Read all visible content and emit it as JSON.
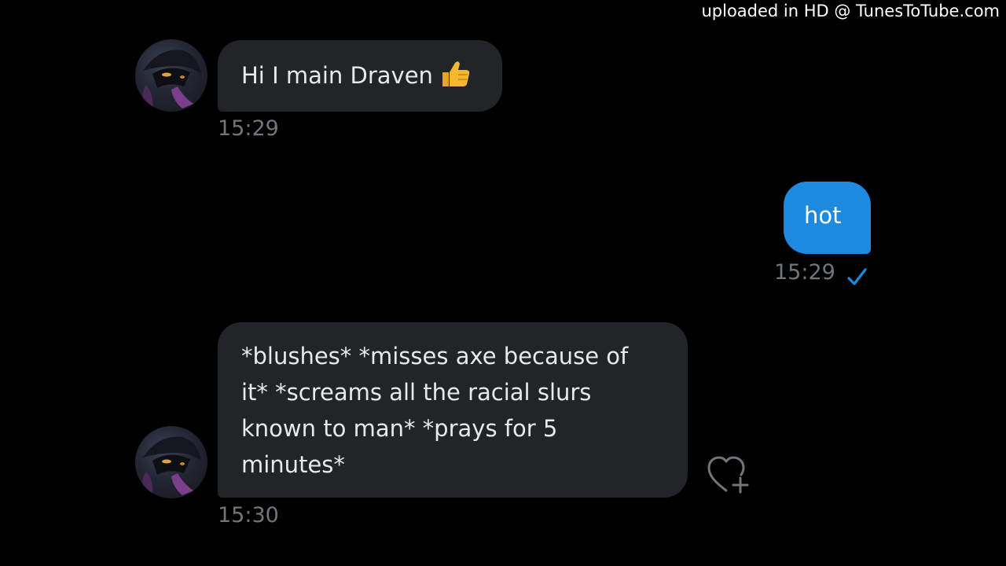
{
  "watermark": "uploaded in HD @ TunesToTube.com",
  "messages": [
    {
      "direction": "incoming",
      "text": "Hi I main Draven",
      "emoji": "thumbs-up-icon",
      "time": "15:29"
    },
    {
      "direction": "outgoing",
      "text": "hot",
      "time": "15:29",
      "status": "check-icon"
    },
    {
      "direction": "incoming",
      "lines": [
        "*blushes* *misses axe because of",
        "it* *screams all the racial slurs",
        "known to man* *prays for 5",
        "minutes*"
      ],
      "time": "15:30",
      "reaction": "add-reaction-heart-icon"
    }
  ],
  "colors": {
    "background": "#000000",
    "incoming_bubble": "#212528",
    "outgoing_bubble": "#1d8ae0",
    "timestamp": "#71767b",
    "check": "#1d8ae0"
  }
}
